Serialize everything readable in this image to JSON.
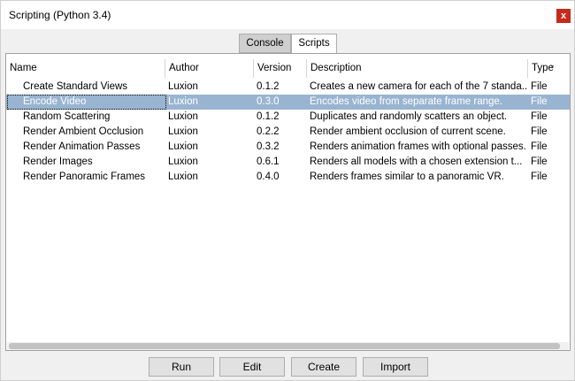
{
  "window": {
    "title": "Scripting (Python 3.4)",
    "close_label": "x"
  },
  "tabs": [
    {
      "label": "Console"
    },
    {
      "label": "Scripts"
    }
  ],
  "table": {
    "columns": [
      "Name",
      "Author",
      "Version",
      "Description",
      "Type"
    ],
    "rows": [
      {
        "name": "Create Standard Views",
        "author": "Luxion",
        "version": "0.1.2",
        "description": "Creates a new camera for each of the 7 standa...",
        "type": "File"
      },
      {
        "name": "Encode Video",
        "author": "Luxion",
        "version": "0.3.0",
        "description": "Encodes video from separate frame range.",
        "type": "File"
      },
      {
        "name": "Random Scattering",
        "author": "Luxion",
        "version": "0.1.2",
        "description": "Duplicates and randomly scatters an object.",
        "type": "File"
      },
      {
        "name": "Render Ambient Occlusion",
        "author": "Luxion",
        "version": "0.2.2",
        "description": "Render ambient occlusion of current scene.",
        "type": "File"
      },
      {
        "name": "Render Animation Passes",
        "author": "Luxion",
        "version": "0.3.2",
        "description": "Renders animation frames with optional passes.",
        "type": "File"
      },
      {
        "name": "Render Images",
        "author": "Luxion",
        "version": "0.6.1",
        "description": "Renders all models with a chosen extension t...",
        "type": "File"
      },
      {
        "name": "Render Panoramic Frames",
        "author": "Luxion",
        "version": "0.4.0",
        "description": "Renders frames similar to a panoramic VR.",
        "type": "File"
      }
    ],
    "selected_row": "Encode Video"
  },
  "buttons": {
    "run": "Run",
    "edit": "Edit",
    "create": "Create",
    "import": "Import"
  },
  "colors": {
    "selection": "#99b4d1",
    "close": "#c42b1c"
  },
  "icons": {
    "close": "close-icon",
    "sort": "chevron-down-icon"
  }
}
